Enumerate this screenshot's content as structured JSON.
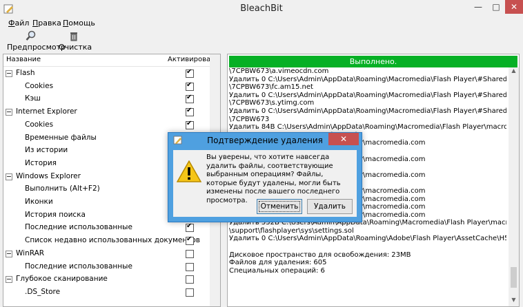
{
  "window": {
    "title": "BleachBit"
  },
  "menu": [
    "Файл",
    "Правка",
    "Помощь"
  ],
  "toolbar": {
    "preview_label": "Предпросмотр",
    "clean_label": "Очистка"
  },
  "tree": {
    "col_name": "Название",
    "col_active": "Активировать",
    "rows": [
      {
        "label": "Flash",
        "level": 0,
        "checked": true
      },
      {
        "label": "Cookies",
        "level": 1,
        "checked": true
      },
      {
        "label": "Кэш",
        "level": 1,
        "checked": true
      },
      {
        "label": "Internet Explorer",
        "level": 0,
        "checked": true
      },
      {
        "label": "Cookies",
        "level": 1,
        "checked": true
      },
      {
        "label": "Временные файлы",
        "level": 1,
        "checked": true
      },
      {
        "label": "Из истории",
        "level": 1,
        "checked": true
      },
      {
        "label": "История",
        "level": 1,
        "checked": true
      },
      {
        "label": "Windows Explorer",
        "level": 0,
        "checked": true
      },
      {
        "label": "Выполнить (Alt+F2)",
        "level": 1,
        "checked": true
      },
      {
        "label": "Иконки",
        "level": 1,
        "checked": true
      },
      {
        "label": "История поиска",
        "level": 1,
        "checked": true
      },
      {
        "label": "Последние использованные",
        "level": 1,
        "checked": true
      },
      {
        "label": "Список недавно использованных документов",
        "level": 1,
        "checked": true
      },
      {
        "label": "WinRAR",
        "level": 0,
        "checked": false
      },
      {
        "label": "Последние использованные",
        "level": 1,
        "checked": false
      },
      {
        "label": "Глубокое сканирование",
        "level": 0,
        "checked": false
      },
      {
        "label": ".DS_Store",
        "level": 1,
        "checked": false
      }
    ]
  },
  "progress": {
    "text": "Выполнено.",
    "color": "#06b025"
  },
  "log": "\\7CPBW673\\a.vimeocdn.com\nУдалить 0 C:\\Users\\Admin\\AppData\\Roaming\\Macromedia\\Flash Player\\#SharedObjects\n\\7CPBW673\\fc.am15.net\nУдалить 0 C:\\Users\\Admin\\AppData\\Roaming\\Macromedia\\Flash Player\\#SharedObjects\n\\7CPBW673\\s.ytimg.com\nУдалить 0 C:\\Users\\Admin\\AppData\\Roaming\\Macromedia\\Flash Player\\#SharedObjects\n\\7CPBW673\nУдалить 84B C:\\Users\\Admin\\AppData\\Roaming\\Macromedia\\Flash Player\\macromedia.com\n                                          ettings.sol\n                                          Flash Player\\macromedia.com\n                                          ngs.sol\n                                          Flash Player\\macromedia.com\n                                          ngs.sol\n                                          Flash Player\\macromedia.com\n                                          gs.sol\n                                          Flash Player\\macromedia.com\n                                          Flash Player\\macromedia.com\n                                          Flash Player\\macromedia.com\n                                          Flash Player\\macromedia.com\nУдалить 552B C:\\Users\\Admin\\AppData\\Roaming\\Macromedia\\Flash Player\\macromedia.com\n\\support\\flashplayer\\sys\\settings.sol\nУдалить 0 C:\\Users\\Admin\\AppData\\Roaming\\Adobe\\Flash Player\\AssetCache\\H5BDZQDU\n\nДисковое пространство для освобождения: 23MB\nФайлов для удаления: 605\nСпециальных операций: 6",
  "dialog": {
    "title": "Подтверждение удаления",
    "message": "Вы уверены, что хотите навсегда удалить файлы, соответствующие выбранным операциям? Файлы, которые будут удалены, могли быть изменены после вашего последнего просмотра.",
    "cancel_label": "Отменить",
    "delete_label": "Удалить",
    "close_glyph": "✕"
  },
  "icons": [
    "app-icon",
    "search-icon",
    "trash-icon",
    "warning-icon",
    "close-icon"
  ]
}
